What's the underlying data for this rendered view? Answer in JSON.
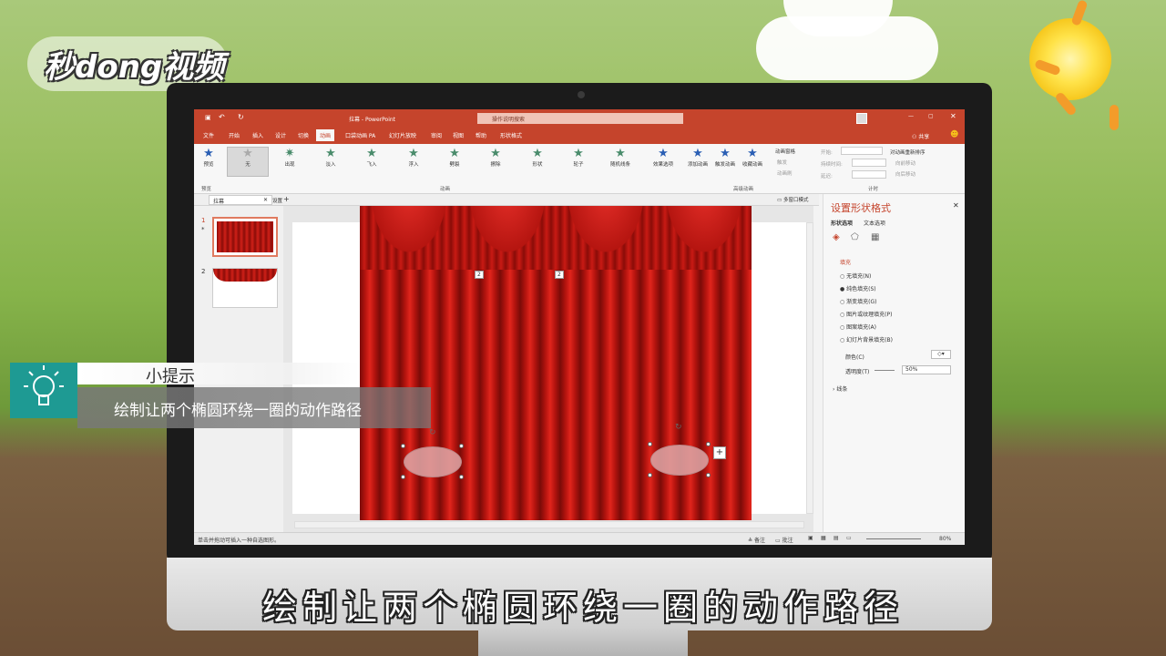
{
  "brand": {
    "logo_text": "秒dong视频"
  },
  "app": {
    "title": "拉幕 - PowerPoint",
    "search_placeholder": "操作说明搜索",
    "share_label": "共享"
  },
  "ribbon_tabs": [
    "文件",
    "开始",
    "插入",
    "设计",
    "切换",
    "动画",
    "口袋动画 PA",
    "幻灯片放映",
    "审阅",
    "视图",
    "帮助",
    "形状格式"
  ],
  "ribbon": {
    "preview": "预览",
    "effects": [
      "无",
      "出现",
      "淡入",
      "飞入",
      "浮入",
      "劈裂",
      "擦除",
      "形状",
      "轮子",
      "随机线条"
    ],
    "effect_options": "效果选项",
    "advanced": [
      "添加动画",
      "触发动画",
      "收藏动画"
    ],
    "animation_pane": "动画窗格",
    "trigger": "触发",
    "animation_painter": "动画刷",
    "timing": {
      "start": "开始:",
      "duration": "持续时间:",
      "delay": "延迟:",
      "reorder": "对动画重新排序",
      "move_earlier": "向前移动",
      "move_later": "向后移动"
    },
    "groups": {
      "preview": "预览",
      "animation": "动画",
      "advanced": "高级动画",
      "timing": "计时"
    }
  },
  "doc_tab": {
    "name": "拉幕",
    "settings": "设置",
    "multi_window": "多窗口模式"
  },
  "slides": [
    {
      "number": "1",
      "star": "*"
    },
    {
      "number": "2"
    }
  ],
  "slide_markers": {
    "marker_a": "2",
    "marker_b": "2"
  },
  "format_panel": {
    "title": "设置形状格式",
    "tabs": [
      "形状选项",
      "文本选项"
    ],
    "fill_section": "填充",
    "fill_options": [
      "无填充(N)",
      "纯色填充(S)",
      "渐变填充(G)",
      "图片或纹理填充(P)",
      "图案填充(A)",
      "幻灯片背景填充(B)"
    ],
    "color_label": "颜色(C)",
    "transparency_label": "透明度(T)",
    "transparency_value": "50%",
    "line_section": "线条"
  },
  "status": {
    "hint": "单击并拖动可插入一种自选图形。",
    "notes": "备注",
    "comments": "批注",
    "zoom": "80%"
  },
  "tip": {
    "title": "小提示",
    "body": "绘制让两个椭圆环绕一圈的动作路径"
  },
  "caption": "绘制让两个椭圆环绕一圈的动作路径"
}
